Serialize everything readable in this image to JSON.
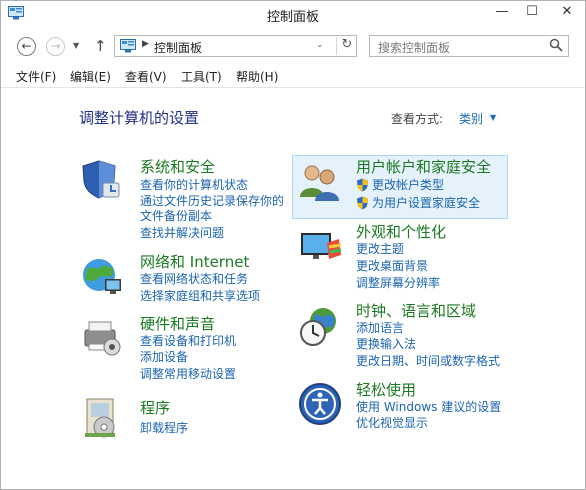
{
  "window": {
    "title": "控制面板",
    "controls": {
      "minimize": "—",
      "maximize": "☐",
      "close": "✕"
    }
  },
  "nav": {
    "back": "←",
    "forward": "→",
    "recent": "▼",
    "up": "↑",
    "address_separator": "▶",
    "address_text": "控制面板",
    "address_dropdown": "⌄",
    "refresh": "↻",
    "search_placeholder": "搜索控制面板"
  },
  "menu": [
    "文件(F)",
    "编辑(E)",
    "查看(V)",
    "工具(T)",
    "帮助(H)"
  ],
  "content": {
    "heading": "调整计算机的设置",
    "view_by_label": "查看方式:",
    "view_by_value": "类别",
    "view_by_arrow": "▼"
  },
  "categories": [
    {
      "title": "系统和安全",
      "icon": "system-security-icon",
      "links": [
        "查看你的计算机状态",
        "通过文件历史记录保存你的",
        "文件备份副本",
        "查找并解决问题"
      ]
    },
    {
      "title": "网络和 Internet",
      "icon": "network-internet-icon",
      "links": [
        "查看网络状态和任务",
        "选择家庭组和共享选项"
      ]
    },
    {
      "title": "硬件和声音",
      "icon": "hardware-sound-icon",
      "links": [
        "查看设备和打印机",
        "添加设备",
        "调整常用移动设置"
      ]
    },
    {
      "title": "程序",
      "icon": "programs-icon",
      "links": [
        "卸载程序"
      ]
    },
    {
      "title": "用户帐户和家庭安全",
      "icon": "user-accounts-icon",
      "links": [
        "更改帐户类型",
        "为用户设置家庭安全"
      ]
    },
    {
      "title": "外观和个性化",
      "icon": "appearance-icon",
      "links": [
        "更改主题",
        "更改桌面背景",
        "调整屏幕分辨率"
      ]
    },
    {
      "title": "时钟、语言和区域",
      "icon": "clock-language-region-icon",
      "links": [
        "添加语言",
        "更换输入法",
        "更改日期、时间或数字格式"
      ]
    },
    {
      "title": "轻松使用",
      "icon": "ease-of-access-icon",
      "links": [
        "使用 Windows 建议的设置",
        "优化视觉显示"
      ]
    }
  ],
  "colors": {
    "category_title": "#1a7a21",
    "link": "#1b64b0",
    "heading": "#1e3287",
    "highlight_bg": "#e6f2fb",
    "highlight_border": "#a9d4f3"
  }
}
